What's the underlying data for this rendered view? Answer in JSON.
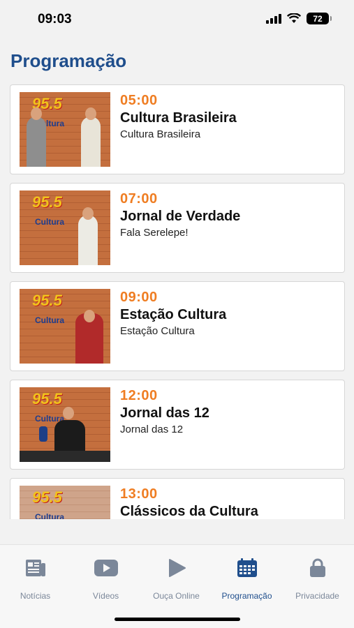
{
  "status": {
    "time": "09:03",
    "battery": "72"
  },
  "page": {
    "title": "Programação"
  },
  "schedule": [
    {
      "time": "05:00",
      "title": "Cultura Brasileira",
      "subtitle": "Cultura Brasileira"
    },
    {
      "time": "07:00",
      "title": "Jornal de Verdade",
      "subtitle": "Fala Serelepe!"
    },
    {
      "time": "09:00",
      "title": "Estação Cultura",
      "subtitle": "Estação Cultura"
    },
    {
      "time": "12:00",
      "title": "Jornal das 12",
      "subtitle": "Jornal das 12"
    },
    {
      "time": "13:00",
      "title": "Clássicos da Cultura",
      "subtitle": ""
    }
  ],
  "thumb_logo": {
    "number": "95.5",
    "word": "Cultura"
  },
  "tabs": [
    {
      "label": "Notícias",
      "icon": "newspaper-icon"
    },
    {
      "label": "Vídeos",
      "icon": "video-icon"
    },
    {
      "label": "Ouça Online",
      "icon": "play-icon"
    },
    {
      "label": "Programação",
      "icon": "calendar-icon"
    },
    {
      "label": "Privacidade",
      "icon": "lock-icon"
    }
  ],
  "colors": {
    "accent": "#1f4e8c",
    "time": "#ef7d22",
    "tab_inactive": "#7b8799"
  }
}
